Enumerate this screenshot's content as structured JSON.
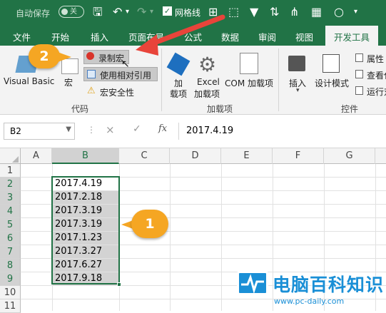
{
  "qat": {
    "autosave": "自动保存",
    "toggle": "关",
    "gridlines": "网格线"
  },
  "tabs": [
    "文件",
    "开始",
    "插入",
    "页面布局",
    "公式",
    "数据",
    "审阅",
    "视图",
    "开发工具"
  ],
  "ribbon": {
    "visual_basic": "Visual Basic",
    "macro": "宏",
    "record_macro": "录制宏",
    "relative_ref": "使用相对引用",
    "macro_security": "宏安全性",
    "addins": "加\n载项",
    "addins_line1": "加",
    "addins_line2": "载项",
    "excel_addins_line1": "Excel",
    "excel_addins_line2": "加载项",
    "com_addins": "COM 加载项",
    "insert": "插入",
    "design_mode": "设计模式",
    "properties": "属性",
    "view_code": "查看代",
    "run_dialog": "运行对",
    "group_code": "代码",
    "group_addins": "加载项",
    "group_controls": "控件"
  },
  "formula_bar": {
    "name_box": "B2",
    "cancel": "×",
    "enter": "✓",
    "fx": "fx",
    "value": "2017.4.19"
  },
  "columns": [
    "A",
    "B",
    "C",
    "D",
    "E",
    "F",
    "G"
  ],
  "rows": [
    "1",
    "2",
    "3",
    "4",
    "5",
    "6",
    "7",
    "8",
    "9",
    "10",
    "11"
  ],
  "cells": [
    "2017.4.19",
    "2017.2.18",
    "2017.3.19",
    "2017.3.19",
    "2017.1.23",
    "2017.3.27",
    "2017.6.27",
    "2017.9.18"
  ],
  "badges": {
    "step1": "1",
    "step2": "2"
  },
  "watermark": {
    "title": "电脑百科知识",
    "url": "www.pc-daily.com"
  },
  "colors": {
    "excel_green": "#217346",
    "badge_orange": "#f5a623",
    "arrow_red": "#e8443a"
  }
}
